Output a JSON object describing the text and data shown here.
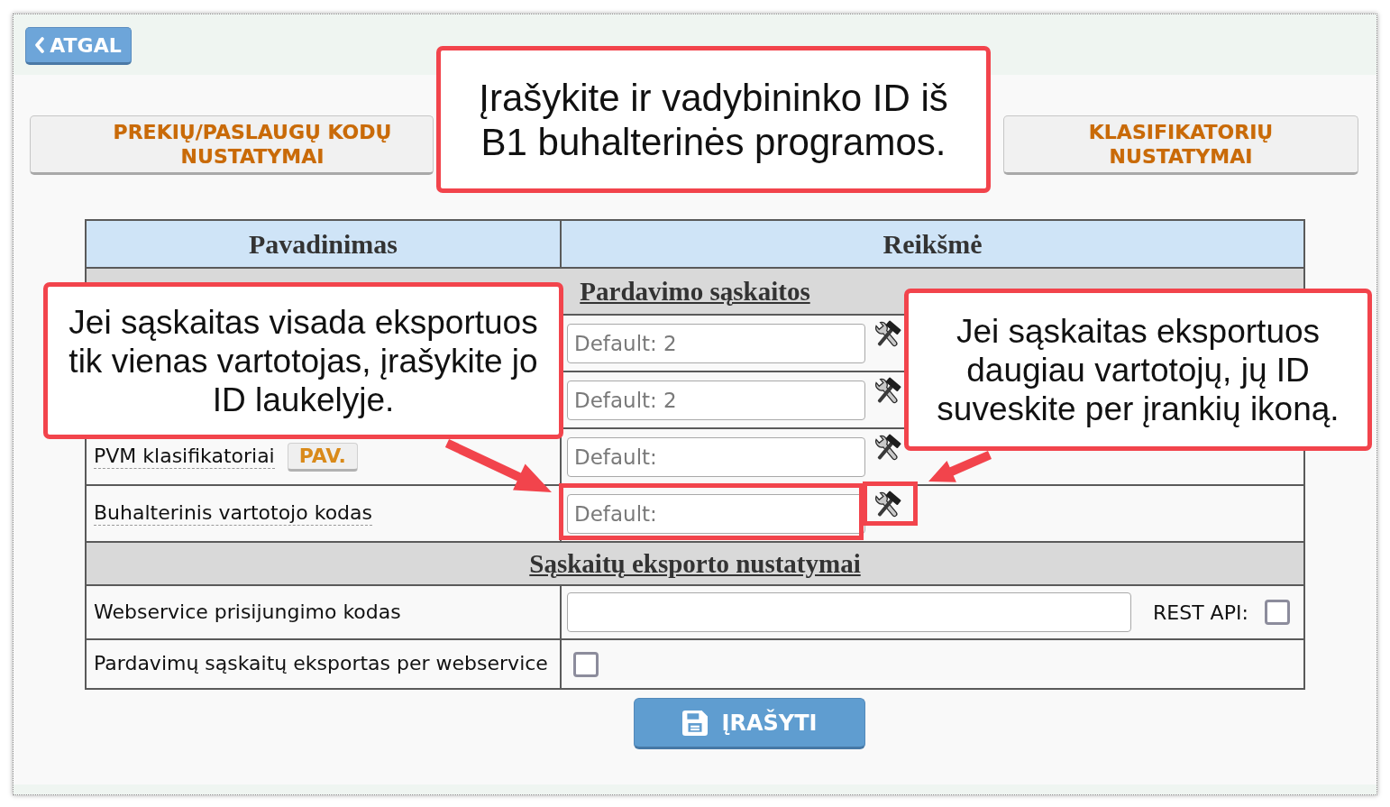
{
  "back_button": {
    "label": "ATGAL"
  },
  "nav_buttons": [
    {
      "label": "PREKIŲ/PASLAUGŲ KODŲ NUSTATYMAI"
    },
    {
      "label": "KLASIFIKATORIŲ NUSTATYMAI"
    }
  ],
  "table": {
    "columns": [
      "Pavadinimas",
      "Reikšmė"
    ],
    "sections": [
      {
        "title": "Pardavimo sąskaitos",
        "rows": [
          {
            "kind": "id_field",
            "placeholder": "Default: 2"
          },
          {
            "kind": "id_field",
            "placeholder": "Default: 2"
          },
          {
            "kind": "id_field",
            "label": "PVM klasifikatoriai",
            "has_tooltip": true,
            "button": "PAV.",
            "placeholder": "Default:"
          },
          {
            "kind": "id_field",
            "label": "Buhalterinis vartotojo kodas",
            "has_tooltip": true,
            "placeholder": "Default:"
          }
        ]
      },
      {
        "title": "Sąskaitų eksporto nustatymai",
        "rows": [
          {
            "kind": "text_field",
            "label": "Webservice prisijungimo kodas",
            "has_tooltip": false,
            "option": {
              "label": "REST API:",
              "checked": false
            }
          },
          {
            "kind": "checkbox",
            "label": "Pardavimų sąskaitų eksportas per webservice",
            "has_tooltip": false,
            "checked": false
          }
        ]
      }
    ]
  },
  "save_button": {
    "label": "ĮRAŠYTI"
  },
  "callouts": [
    {
      "text": "Įrašykite ir vadybininko ID iš B1 buhalterinės programos."
    },
    {
      "text": "Jei sąskaitas visada eksportuos tik vienas vartotojas, įrašykite jo ID laukelyje."
    },
    {
      "text": "Jei sąskaitas eksportuos daugiau vartotojų, jų ID suveskite per įrankių ikoną."
    }
  ]
}
